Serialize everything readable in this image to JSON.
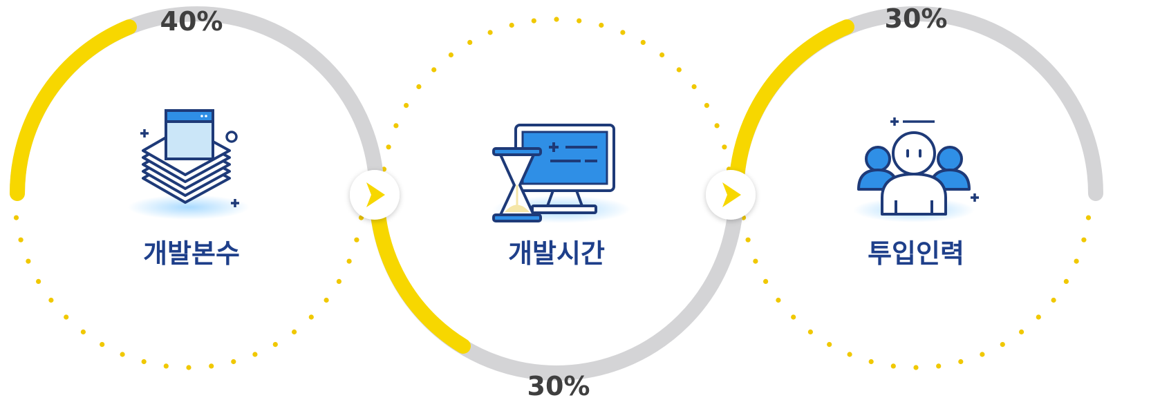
{
  "colors": {
    "accent": "#f7d700",
    "track": "#d4d4d6",
    "dot": "#f0c800",
    "navy": "#1e3a78",
    "blue": "#2f8fe6",
    "text": "#3f3f3f",
    "label": "#1e3f8a"
  },
  "steps": [
    {
      "label": "개발본수",
      "percent": "40%",
      "icon": "stacked-documents-icon",
      "progress": 0.4
    },
    {
      "label": "개발시간",
      "percent": "30%",
      "icon": "monitor-hourglass-icon",
      "progress": 0.3
    },
    {
      "label": "투입인력",
      "percent": "30%",
      "icon": "team-people-icon",
      "progress": 0.3
    }
  ],
  "connectors": [
    {
      "icon": "chevron-right-icon"
    },
    {
      "icon": "chevron-right-icon"
    }
  ]
}
